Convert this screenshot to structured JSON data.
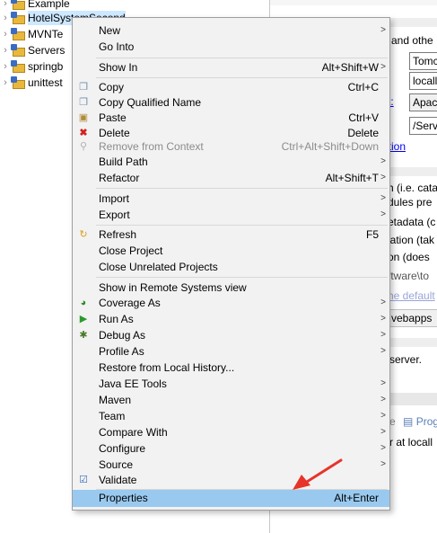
{
  "tree": {
    "items": [
      {
        "label": "Example",
        "selected": false
      },
      {
        "label": "HotelSystemSecond",
        "selected": true
      },
      {
        "label": "MVNTe",
        "selected": false
      },
      {
        "label": "Servers",
        "selected": false
      },
      {
        "label": "springb",
        "selected": false
      },
      {
        "label": "unittest",
        "selected": false
      }
    ]
  },
  "menu": {
    "items": [
      {
        "label": "New",
        "shortcut": "",
        "submenu": true,
        "icon": "",
        "disabled": false
      },
      {
        "label": "Go Into",
        "shortcut": "",
        "submenu": false,
        "icon": "",
        "disabled": false
      },
      {
        "label": "Show In",
        "shortcut": "Alt+Shift+W",
        "submenu": true,
        "icon": "",
        "disabled": false
      },
      {
        "label": "Copy",
        "shortcut": "Ctrl+C",
        "submenu": false,
        "icon": "copy-icon",
        "disabled": false
      },
      {
        "label": "Copy Qualified Name",
        "shortcut": "",
        "submenu": false,
        "icon": "copy-qualified-icon",
        "disabled": false
      },
      {
        "label": "Paste",
        "shortcut": "Ctrl+V",
        "submenu": false,
        "icon": "paste-icon",
        "disabled": false
      },
      {
        "label": "Delete",
        "shortcut": "Delete",
        "submenu": false,
        "icon": "delete-icon",
        "disabled": false
      },
      {
        "label": "Remove from Context",
        "shortcut": "Ctrl+Alt+Shift+Down",
        "submenu": false,
        "icon": "remove-context-icon",
        "disabled": true
      },
      {
        "label": "Build Path",
        "shortcut": "",
        "submenu": true,
        "icon": "",
        "disabled": false
      },
      {
        "label": "Refactor",
        "shortcut": "Alt+Shift+T",
        "submenu": true,
        "icon": "",
        "disabled": false
      },
      {
        "label": "Import",
        "shortcut": "",
        "submenu": true,
        "icon": "",
        "disabled": false
      },
      {
        "label": "Export",
        "shortcut": "",
        "submenu": true,
        "icon": "",
        "disabled": false
      },
      {
        "label": "Refresh",
        "shortcut": "F5",
        "submenu": false,
        "icon": "refresh-icon",
        "disabled": false
      },
      {
        "label": "Close Project",
        "shortcut": "",
        "submenu": false,
        "icon": "",
        "disabled": false
      },
      {
        "label": "Close Unrelated Projects",
        "shortcut": "",
        "submenu": false,
        "icon": "",
        "disabled": false
      },
      {
        "label": "Show in Remote Systems view",
        "shortcut": "",
        "submenu": false,
        "icon": "",
        "disabled": false
      },
      {
        "label": "Coverage As",
        "shortcut": "",
        "submenu": true,
        "icon": "coverage-icon",
        "disabled": false
      },
      {
        "label": "Run As",
        "shortcut": "",
        "submenu": true,
        "icon": "run-icon",
        "disabled": false
      },
      {
        "label": "Debug As",
        "shortcut": "",
        "submenu": true,
        "icon": "debug-icon",
        "disabled": false
      },
      {
        "label": "Profile As",
        "shortcut": "",
        "submenu": true,
        "icon": "",
        "disabled": false
      },
      {
        "label": "Restore from Local History...",
        "shortcut": "",
        "submenu": false,
        "icon": "",
        "disabled": false
      },
      {
        "label": "Java EE Tools",
        "shortcut": "",
        "submenu": true,
        "icon": "",
        "disabled": false
      },
      {
        "label": "Maven",
        "shortcut": "",
        "submenu": true,
        "icon": "",
        "disabled": false
      },
      {
        "label": "Team",
        "shortcut": "",
        "submenu": true,
        "icon": "",
        "disabled": false
      },
      {
        "label": "Compare With",
        "shortcut": "",
        "submenu": true,
        "icon": "",
        "disabled": false
      },
      {
        "label": "Configure",
        "shortcut": "",
        "submenu": true,
        "icon": "",
        "disabled": false
      },
      {
        "label": "Source",
        "shortcut": "",
        "submenu": true,
        "icon": "",
        "disabled": false
      },
      {
        "label": "Validate",
        "shortcut": "",
        "submenu": false,
        "icon": "checkbox-icon",
        "disabled": false
      },
      {
        "label": "Properties",
        "shortcut": "Alt+Enter",
        "submenu": false,
        "icon": "",
        "disabled": false,
        "highlighted": true
      }
    ],
    "submenu_glyph": ">"
  },
  "right": {
    "texts": [
      "and othe",
      "Tomc",
      "locall",
      "t:",
      "Apac",
      "/Serv",
      "ration",
      "h (i.e. cata",
      "dules pre",
      "etadata (c",
      "lation (tak",
      "on (does",
      "ftware\\to",
      "he default",
      "vebapps",
      "server.",
      "e",
      "Prog",
      "r at locall"
    ]
  },
  "colors": {
    "menu_bg": "#f2f2f2",
    "highlight": "#99c9ef",
    "selection": "#cde8ff",
    "annotation_arrow": "#e8332a"
  }
}
